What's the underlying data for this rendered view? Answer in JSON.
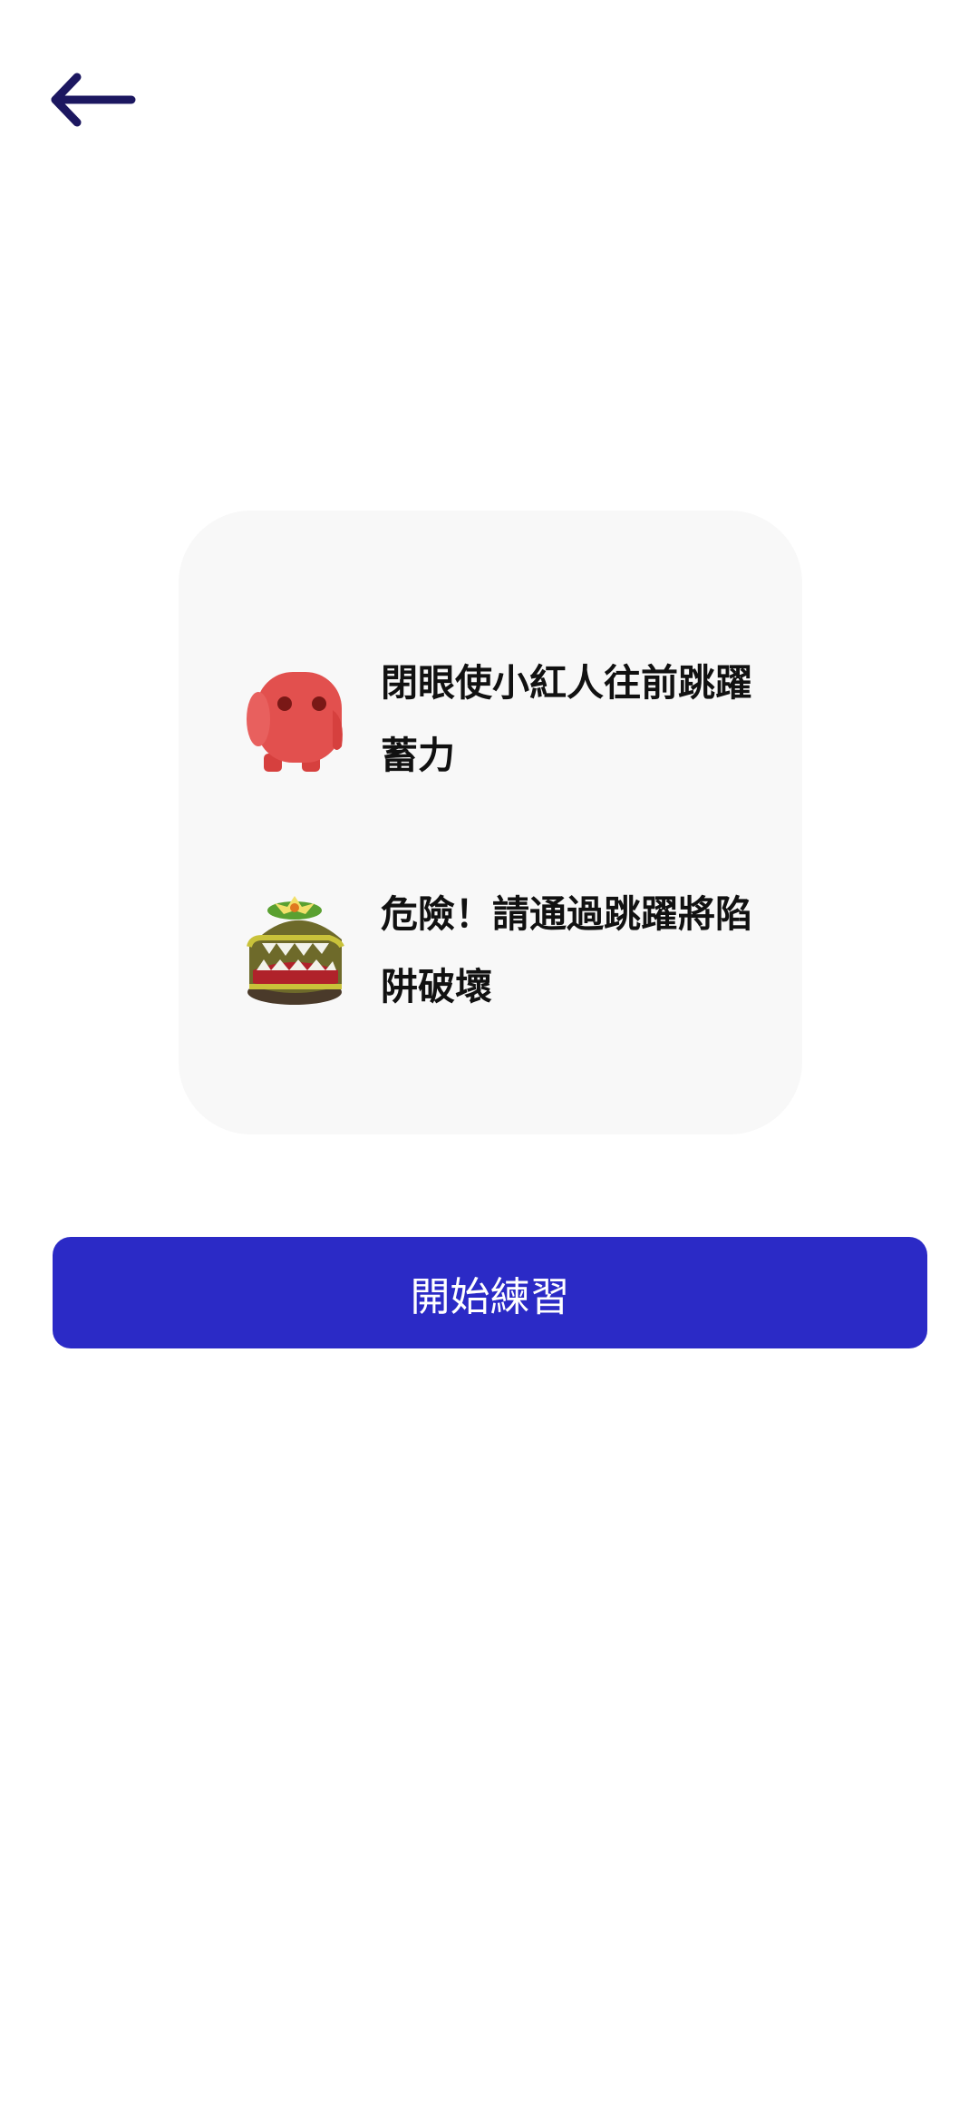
{
  "header": {
    "back_icon": "arrow-left-icon"
  },
  "instructions": {
    "items": [
      {
        "icon": "red-character-icon",
        "text": "閉眼使小紅人往前跳躍蓄力"
      },
      {
        "icon": "trap-monster-icon",
        "text": "危險！請通過跳躍將陷阱破壞"
      }
    ]
  },
  "actions": {
    "start_label": "開始練習"
  },
  "colors": {
    "accent": "#2b2ac6",
    "back_arrow": "#1c1760",
    "card_bg": "#f8f8f8",
    "character_red": "#e2504e"
  }
}
